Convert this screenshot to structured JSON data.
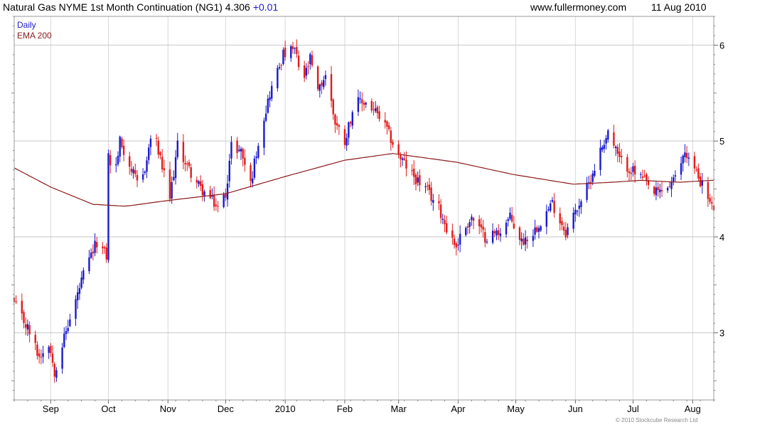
{
  "header": {
    "title": "Natural Gas NYME 1st Month Continuation (NG1) 4.306",
    "change": "+0.01",
    "site": "www.fullermoney.com",
    "date": "11 Aug 2010"
  },
  "legend": {
    "daily": "Daily",
    "ema": "EMA 200"
  },
  "copyright": "© 2010 Stockcube Research Ltd",
  "colors": {
    "up": "#1a1acc",
    "down": "#e31a1a",
    "ema": "#8b1a1a",
    "grid": "#d8d8d8"
  },
  "chart_data": {
    "type": "candlestick",
    "xlabels": [
      "Sep",
      "Oct",
      "Nov",
      "Dec",
      "2010",
      "Feb",
      "Mar",
      "Apr",
      "May",
      "Jun",
      "Jul",
      "Aug"
    ],
    "yticks": [
      3,
      4,
      5,
      6
    ],
    "ylim": [
      2.3,
      6.3
    ],
    "xlim": [
      "2009-08-13",
      "2010-08-12"
    ],
    "grid": true,
    "legend_position": "top-left",
    "price_anchors": [
      [
        "2009-08-13",
        3.3
      ],
      [
        "2009-08-20",
        3.05
      ],
      [
        "2009-08-26",
        2.75
      ],
      [
        "2009-08-31",
        2.9
      ],
      [
        "2009-09-03",
        2.6
      ],
      [
        "2009-09-08",
        2.95
      ],
      [
        "2009-09-12",
        3.2
      ],
      [
        "2009-09-18",
        3.6
      ],
      [
        "2009-09-25",
        3.95
      ],
      [
        "2009-09-30",
        3.8
      ],
      [
        "2009-10-01",
        4.85
      ],
      [
        "2009-10-04",
        4.6
      ],
      [
        "2009-10-07",
        5.0
      ],
      [
        "2009-10-13",
        4.7
      ],
      [
        "2009-10-17",
        4.5
      ],
      [
        "2009-10-21",
        4.8
      ],
      [
        "2009-10-24",
        5.15
      ],
      [
        "2009-10-28",
        4.8
      ],
      [
        "2009-11-02",
        4.4
      ],
      [
        "2009-11-06",
        4.95
      ],
      [
        "2009-11-12",
        4.7
      ],
      [
        "2009-11-18",
        4.5
      ],
      [
        "2009-11-23",
        4.4
      ],
      [
        "2009-11-27",
        4.3
      ],
      [
        "2009-12-01",
        4.45
      ],
      [
        "2009-12-04",
        4.95
      ],
      [
        "2009-12-09",
        4.9
      ],
      [
        "2009-12-14",
        4.55
      ],
      [
        "2009-12-18",
        5.0
      ],
      [
        "2009-12-24",
        5.5
      ],
      [
        "2009-12-31",
        5.9
      ],
      [
        "2010-01-06",
        5.95
      ],
      [
        "2010-01-10",
        5.6
      ],
      [
        "2010-01-14",
        5.85
      ],
      [
        "2010-01-18",
        5.5
      ],
      [
        "2010-01-22",
        5.7
      ],
      [
        "2010-01-27",
        5.2
      ],
      [
        "2010-02-01",
        5.0
      ],
      [
        "2010-02-06",
        5.4
      ],
      [
        "2010-02-12",
        5.4
      ],
      [
        "2010-02-17",
        5.3
      ],
      [
        "2010-02-22",
        5.15
      ],
      [
        "2010-03-01",
        4.85
      ],
      [
        "2010-03-08",
        4.65
      ],
      [
        "2010-03-15",
        4.5
      ],
      [
        "2010-03-22",
        4.3
      ],
      [
        "2010-03-27",
        4.05
      ],
      [
        "2010-03-31",
        3.9
      ],
      [
        "2010-04-03",
        4.05
      ],
      [
        "2010-04-08",
        4.2
      ],
      [
        "2010-04-15",
        4.0
      ],
      [
        "2010-04-22",
        4.05
      ],
      [
        "2010-04-28",
        4.2
      ],
      [
        "2010-05-04",
        3.95
      ],
      [
        "2010-05-10",
        4.05
      ],
      [
        "2010-05-15",
        4.2
      ],
      [
        "2010-05-20",
        4.35
      ],
      [
        "2010-05-27",
        4.05
      ],
      [
        "2010-06-03",
        4.35
      ],
      [
        "2010-06-08",
        4.55
      ],
      [
        "2010-06-13",
        4.85
      ],
      [
        "2010-06-18",
        5.1
      ],
      [
        "2010-06-24",
        4.8
      ],
      [
        "2010-06-30",
        4.7
      ],
      [
        "2010-07-06",
        4.6
      ],
      [
        "2010-07-12",
        4.45
      ],
      [
        "2010-07-18",
        4.5
      ],
      [
        "2010-07-23",
        4.6
      ],
      [
        "2010-07-28",
        4.9
      ],
      [
        "2010-08-02",
        4.7
      ],
      [
        "2010-08-06",
        4.55
      ],
      [
        "2010-08-11",
        4.306
      ]
    ],
    "ema_anchors": [
      [
        "2009-08-13",
        4.72
      ],
      [
        "2009-09-01",
        4.52
      ],
      [
        "2009-09-23",
        4.34
      ],
      [
        "2009-10-10",
        4.32
      ],
      [
        "2009-11-01",
        4.38
      ],
      [
        "2009-12-01",
        4.45
      ],
      [
        "2010-01-01",
        4.63
      ],
      [
        "2010-02-01",
        4.8
      ],
      [
        "2010-02-26",
        4.87
      ],
      [
        "2010-03-31",
        4.78
      ],
      [
        "2010-04-30",
        4.65
      ],
      [
        "2010-05-31",
        4.55
      ],
      [
        "2010-06-20",
        4.57
      ],
      [
        "2010-07-05",
        4.59
      ],
      [
        "2010-07-25",
        4.57
      ],
      [
        "2010-08-11",
        4.59
      ]
    ]
  }
}
